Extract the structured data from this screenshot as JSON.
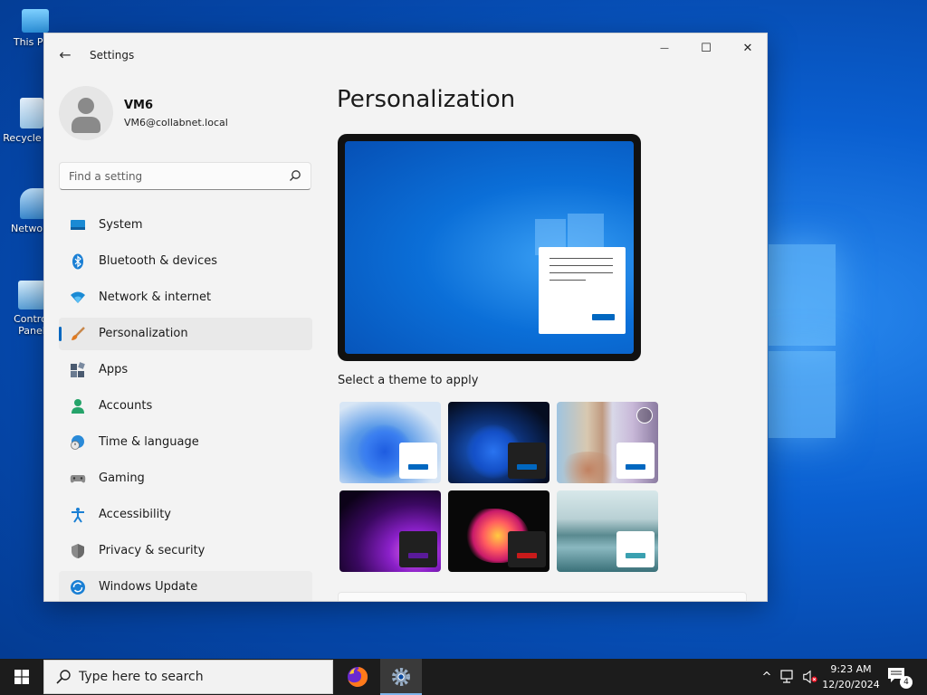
{
  "desktop": {
    "icons": [
      {
        "label": "This PC"
      },
      {
        "label": "Recycle Bin"
      },
      {
        "label": "Network"
      },
      {
        "label": "Control Panel"
      }
    ]
  },
  "window": {
    "app_title": "Settings",
    "back_glyph": "←",
    "minimize_glyph": "—",
    "maximize_glyph": "☐",
    "close_glyph": "✕"
  },
  "profile": {
    "name": "VM6",
    "email": "VM6@collabnet.local"
  },
  "search": {
    "placeholder": "Find a setting",
    "icon": "search-icon"
  },
  "nav": {
    "items": [
      {
        "label": "System",
        "icon": "system-monitor-icon",
        "active": false
      },
      {
        "label": "Bluetooth & devices",
        "icon": "bluetooth-icon",
        "active": false
      },
      {
        "label": "Network & internet",
        "icon": "wifi-icon",
        "active": false
      },
      {
        "label": "Personalization",
        "icon": "paintbrush-icon",
        "active": true
      },
      {
        "label": "Apps",
        "icon": "apps-icon",
        "active": false
      },
      {
        "label": "Accounts",
        "icon": "person-icon",
        "active": false
      },
      {
        "label": "Time & language",
        "icon": "globe-clock-icon",
        "active": false
      },
      {
        "label": "Gaming",
        "icon": "gamepad-icon",
        "active": false
      },
      {
        "label": "Accessibility",
        "icon": "accessibility-icon",
        "active": false
      },
      {
        "label": "Privacy & security",
        "icon": "shield-icon",
        "active": false
      },
      {
        "label": "Windows Update",
        "icon": "update-icon",
        "active": false
      }
    ]
  },
  "content": {
    "title": "Personalization",
    "themes_label": "Select a theme to apply",
    "themes": [
      {
        "name": "windows-light",
        "mini_color": "#ffffff",
        "bar_color": "#0067c0"
      },
      {
        "name": "windows-dark",
        "mini_color": "#202020",
        "bar_color": "#0067c0"
      },
      {
        "name": "windows-spotlight",
        "mini_color": "#ffffff",
        "bar_color": "#0067c0"
      },
      {
        "name": "glow",
        "mini_color": "#202020",
        "bar_color": "#5a1a9a"
      },
      {
        "name": "captured-motion",
        "mini_color": "#202020",
        "bar_color": "#c81a1a"
      },
      {
        "name": "flow",
        "mini_color": "#ffffff",
        "bar_color": "#3aa0b0"
      }
    ]
  },
  "taskbar": {
    "search_placeholder": "Type here to search",
    "apps": [
      {
        "name": "firefox-icon"
      },
      {
        "name": "settings-gear-icon"
      }
    ],
    "time": "9:23 AM",
    "date": "12/20/2024",
    "notification_count": "4",
    "tray_chevron": "^"
  },
  "colors": {
    "accent": "#0067c0",
    "taskbar_bg": "#1c1c1c",
    "window_bg": "#f3f3f3"
  }
}
